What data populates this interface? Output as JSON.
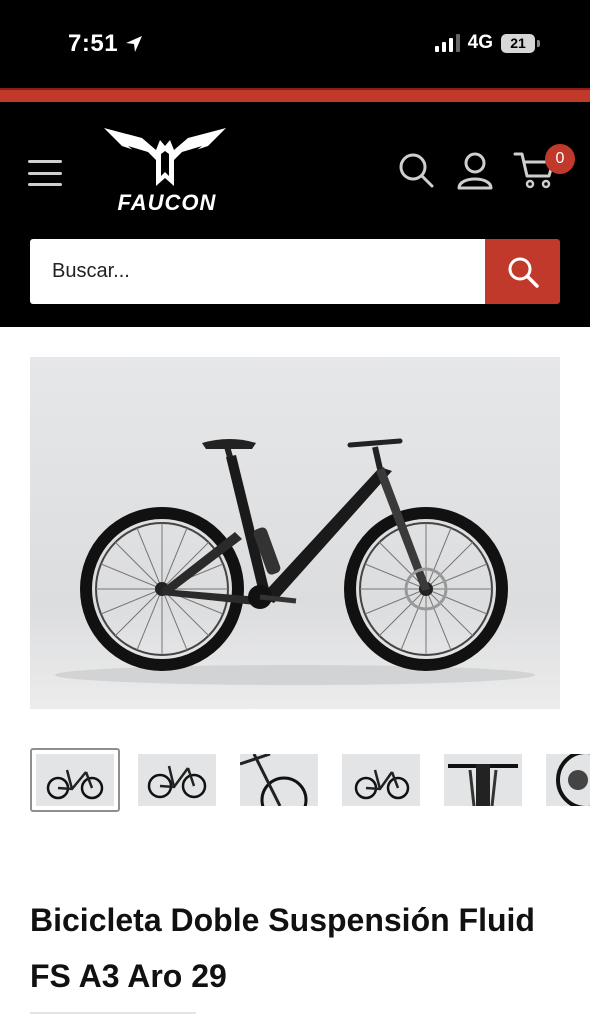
{
  "status_bar": {
    "time": "7:51",
    "network": "4G",
    "battery": "21"
  },
  "header": {
    "brand": "FAUCON",
    "cart_count": "0",
    "search": {
      "placeholder": "Buscar..."
    }
  },
  "product": {
    "title": "Bicicleta Doble Suspensión Fluid FS A3 Aro 29",
    "gallery": {
      "thumbnails": [
        "bike-side",
        "bike-side",
        "bike-detail",
        "bike-side",
        "bike-handlebar",
        "bike-drivetrain"
      ],
      "active_index": 0
    }
  },
  "colors": {
    "header_bg": "#000000",
    "accent": "#c1392b",
    "image_bg": "#e3e4e5"
  },
  "icons": [
    "location-arrow-icon",
    "signal-icon",
    "battery-icon",
    "hamburger-menu-icon",
    "search-icon",
    "user-icon",
    "cart-icon"
  ]
}
